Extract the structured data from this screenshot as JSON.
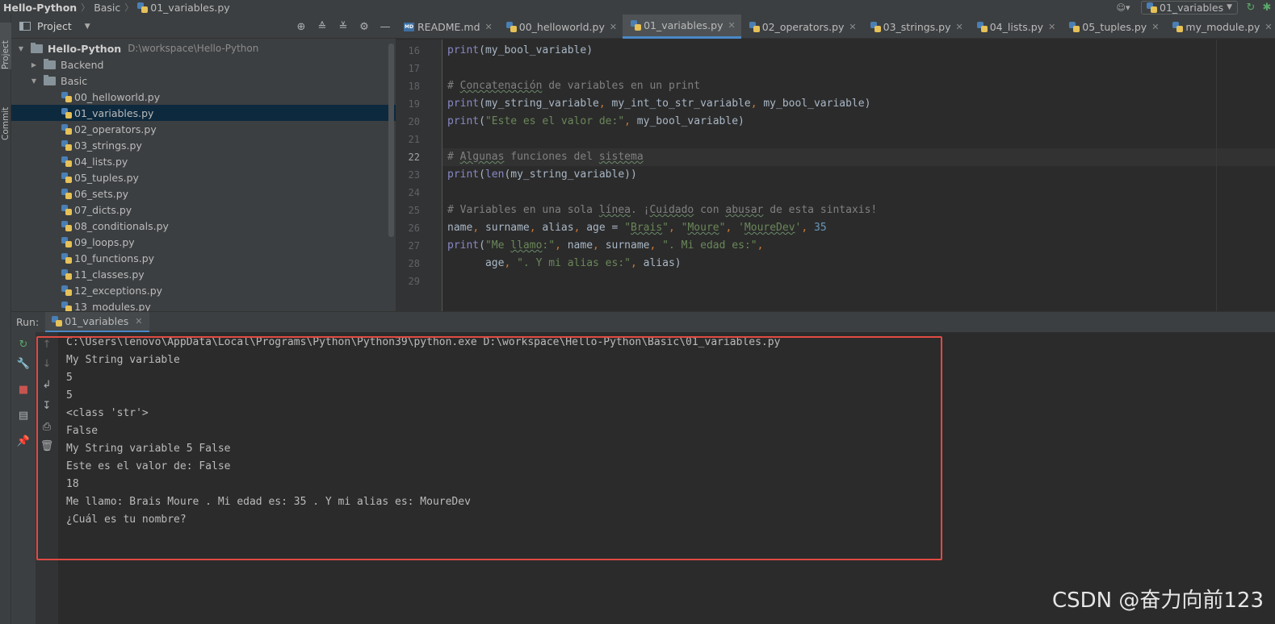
{
  "navbar": {
    "project": "Hello-Python",
    "folder": "Basic",
    "file": "01_variables.py",
    "run_config": "01_variables"
  },
  "left_strip": {
    "project_tab": "Project",
    "commit_tab": "Commit"
  },
  "project_panel": {
    "title": "Project",
    "root": {
      "name": "Hello-Python",
      "path": "D:\\workspace\\Hello-Python"
    },
    "folders": [
      "Backend",
      "Basic"
    ],
    "files": [
      "00_helloworld.py",
      "01_variables.py",
      "02_operators.py",
      "03_strings.py",
      "04_lists.py",
      "05_tuples.py",
      "06_sets.py",
      "07_dicts.py",
      "08_conditionals.py",
      "09_loops.py",
      "10_functions.py",
      "11_classes.py",
      "12_exceptions.py",
      "13_modules.py"
    ],
    "selected_file": "01_variables.py"
  },
  "editor_tabs": [
    "README.md",
    "00_helloworld.py",
    "01_variables.py",
    "02_operators.py",
    "03_strings.py",
    "04_lists.py",
    "05_tuples.py",
    "my_module.py"
  ],
  "active_tab": "01_variables.py",
  "editor": {
    "line_numbers": [
      "16",
      "17",
      "18",
      "19",
      "20",
      "21",
      "22",
      "23",
      "24",
      "25",
      "26",
      "27",
      "28",
      "29"
    ],
    "current_line": "22",
    "lines": [
      "print(my_bool_variable)",
      "",
      "# Concatenación de variables en un print",
      "print(my_string_variable, my_int_to_str_variable, my_bool_variable)",
      "print(\"Este es el valor de:\", my_bool_variable)",
      "",
      "# Algunas funciones del sistema",
      "print(len(my_string_variable))",
      "",
      "# Variables en una sola línea. ¡Cuidado con abusar de esta sintaxis!",
      "name, surname, alias, age = \"Brais\", \"Moure\", 'MoureDev', 35",
      "print(\"Me llamo:\", name, surname, \". Mi edad es:\",",
      "      age, \". Y mi alias es:\", alias)",
      ""
    ]
  },
  "run_panel": {
    "label": "Run:",
    "tab": "01_variables",
    "output": [
      "C:\\Users\\lenovo\\AppData\\Local\\Programs\\Python\\Python39\\python.exe D:\\workspace\\Hello-Python\\Basic\\01_variables.py",
      "My String variable",
      "5",
      "5",
      "<class 'str'>",
      "False",
      "My String variable 5 False",
      "Este es el valor de: False",
      "18",
      "Me llamo: Brais Moure . Mi edad es: 35 . Y mi alias es: MoureDev",
      "¿Cuál es tu nombre?"
    ]
  },
  "watermark": "CSDN @奋力向前123",
  "colors": {
    "accent": "#4a88c7",
    "highlight_box": "#e04a43",
    "string": "#6a8759",
    "number": "#6897bb",
    "comment": "#808080",
    "builtin": "#8888c6",
    "keyword_op": "#cc7832"
  }
}
